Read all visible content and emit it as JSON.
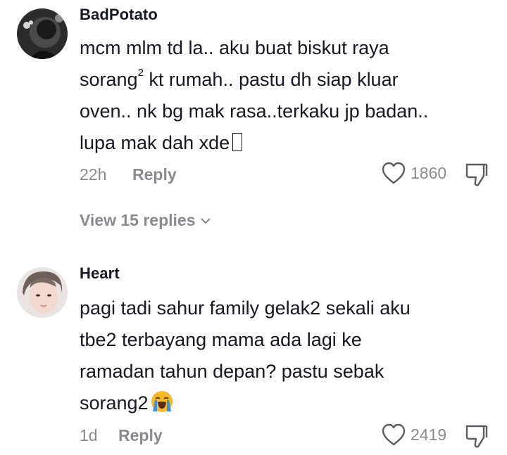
{
  "comments": [
    {
      "username": "BadPotato",
      "text_lines": [
        "mcm mlm td la.. aku buat biskut raya",
        "sorang",
        "2",
        " kt rumah.. pastu dh siap kluar",
        "oven.. nk bg mak rasa..terkaku jp badan..",
        "lupa mak dah xde"
      ],
      "time": "22h",
      "reply_label": "Reply",
      "likes": "1860",
      "view_replies": "View 15 replies"
    },
    {
      "username": "Heart",
      "text_lines": [
        "pagi tadi sahur family gelak2 sekali aku",
        "tbe2 terbayang mama ada lagi ke",
        "ramadan tahun depan? pastu sebak",
        "sorang2"
      ],
      "time": "1d",
      "reply_label": "Reply",
      "likes": "2419"
    }
  ],
  "icons": {
    "like": "heart-outline-icon",
    "dislike": "thumbs-down-icon",
    "expand": "chevron-down-icon",
    "crying_emoji": "loudly-crying-face-emoji"
  }
}
